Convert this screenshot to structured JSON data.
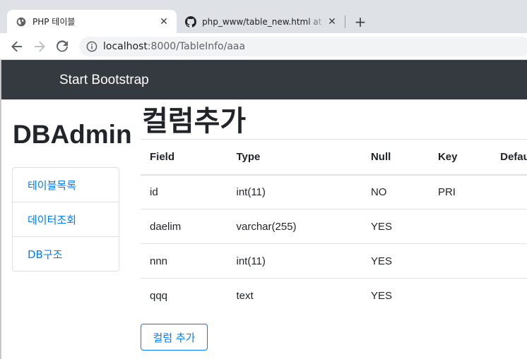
{
  "browser": {
    "tabs": [
      {
        "title": "PHP 테이블",
        "icon": "globe-icon",
        "active": true
      },
      {
        "title": "php_www/table_new.html at ma",
        "icon": "github-icon",
        "active": false
      }
    ],
    "close_glyph": "✕",
    "new_tab_glyph": "+",
    "url": {
      "host": "localhost",
      "rest": ":8000/TableInfo/aaa"
    }
  },
  "navbar": {
    "brand": "Start Bootstrap"
  },
  "sidebar": {
    "title": "DBAdmin",
    "items": [
      {
        "label": "테이블목록"
      },
      {
        "label": "데이터조회"
      },
      {
        "label": "DB구조"
      }
    ]
  },
  "main": {
    "title": "컬럼추가",
    "table": {
      "headers": [
        "Field",
        "Type",
        "Null",
        "Key",
        "Default"
      ],
      "rows": [
        [
          "id",
          "int(11)",
          "NO",
          "PRI",
          ""
        ],
        [
          "daelim",
          "varchar(255)",
          "YES",
          "",
          ""
        ],
        [
          "nnn",
          "int(11)",
          "YES",
          "",
          ""
        ],
        [
          "qqq",
          "text",
          "YES",
          "",
          ""
        ]
      ]
    },
    "add_button": "컬럼 추가"
  },
  "colors": {
    "navbar": "#343a40",
    "link": "#007bff",
    "tabstrip": "#dee1e6"
  }
}
